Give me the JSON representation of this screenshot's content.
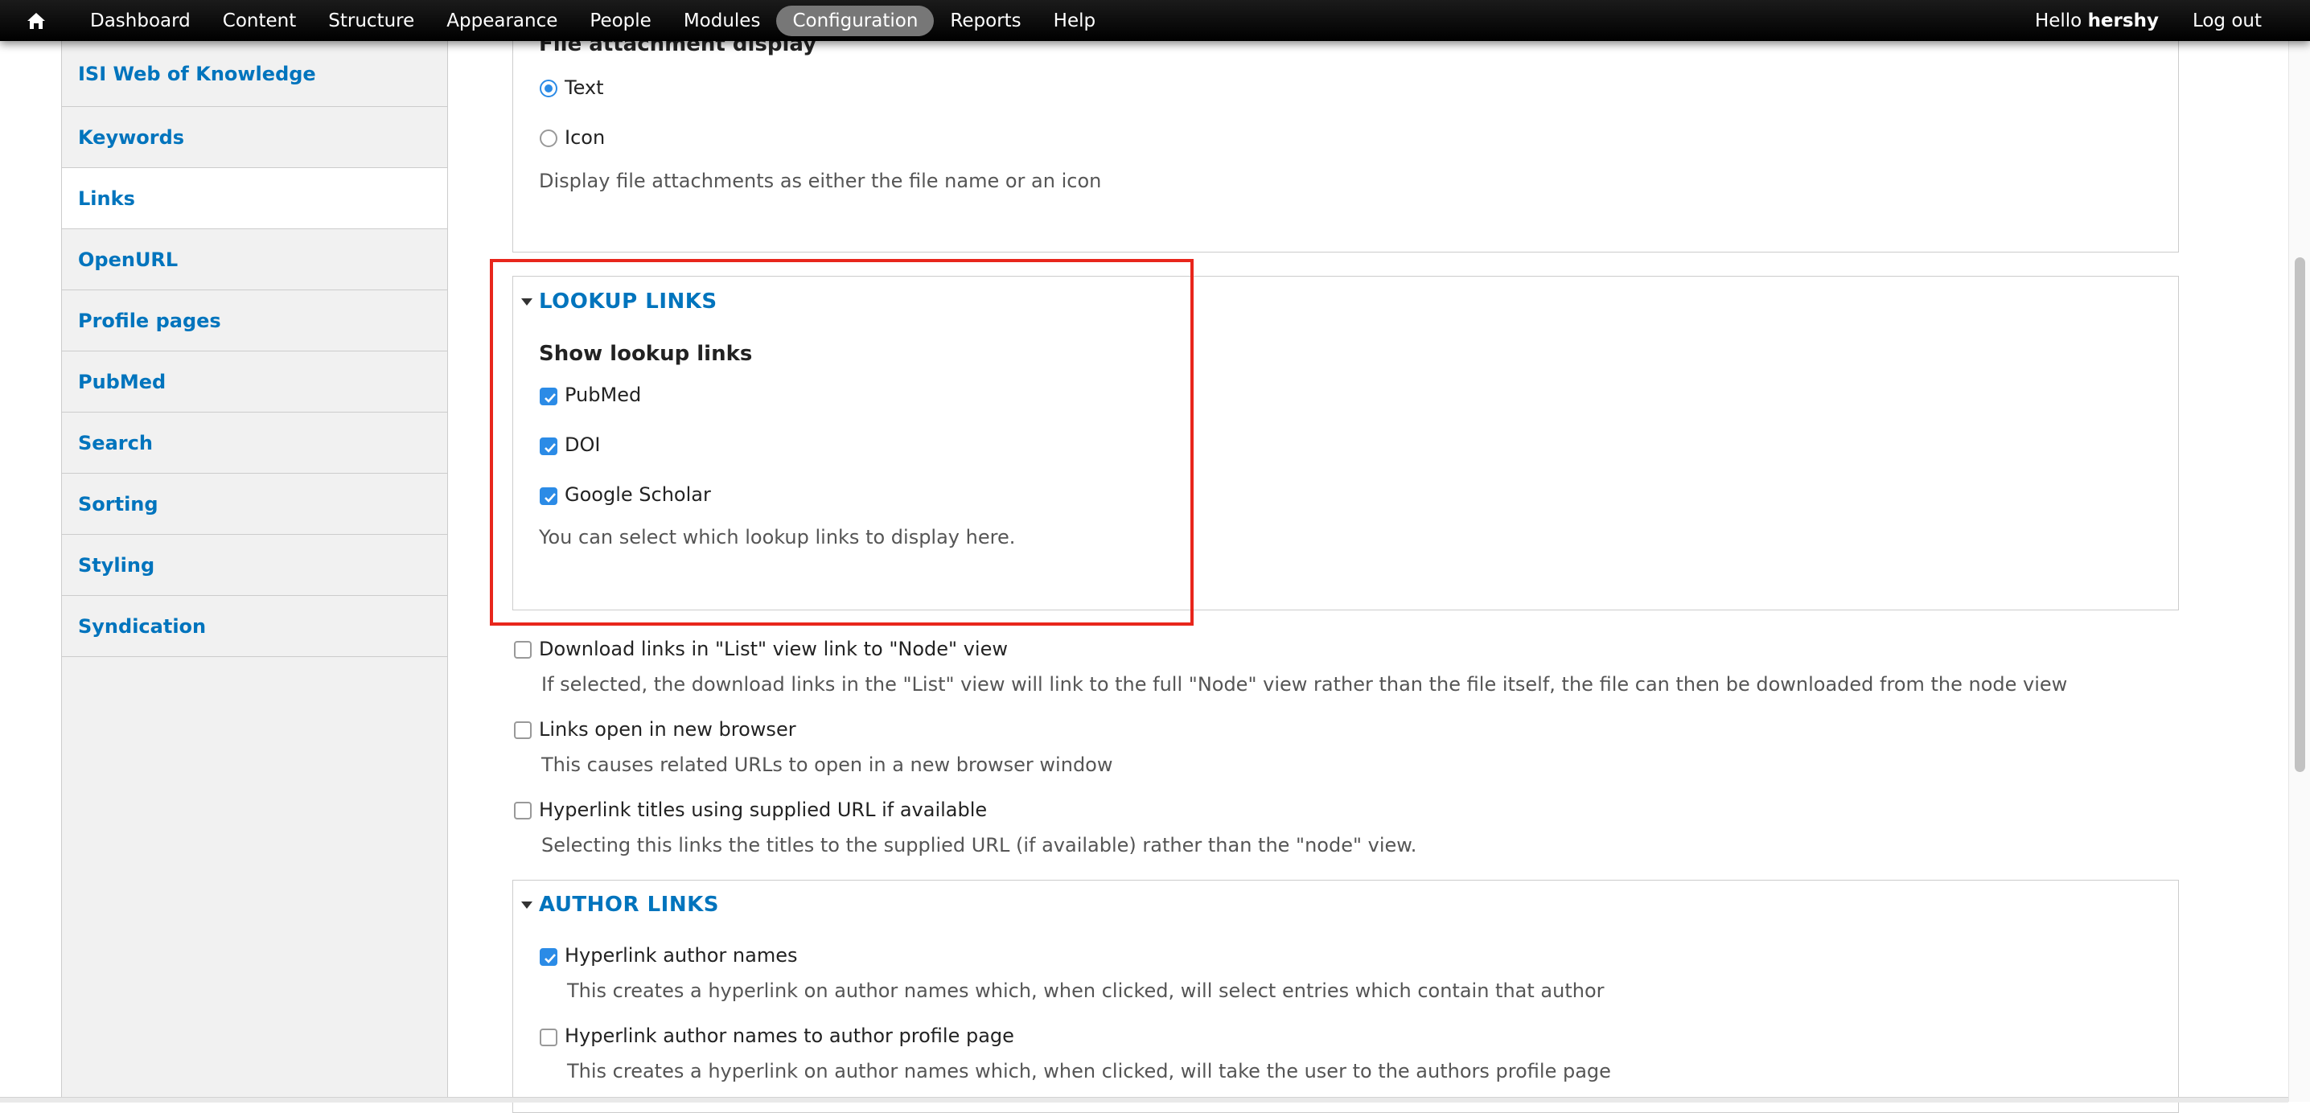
{
  "toolbar": {
    "items": [
      "Dashboard",
      "Content",
      "Structure",
      "Appearance",
      "People",
      "Modules",
      "Configuration",
      "Reports",
      "Help"
    ],
    "active": "Configuration",
    "greeting_prefix": "Hello ",
    "username": "hershy",
    "logout": "Log out"
  },
  "sidebar": {
    "items": [
      {
        "label": "ISI Web of Knowledge"
      },
      {
        "label": "Keywords"
      },
      {
        "label": "Links"
      },
      {
        "label": "OpenURL"
      },
      {
        "label": "Profile pages"
      },
      {
        "label": "PubMed"
      },
      {
        "label": "Search"
      },
      {
        "label": "Sorting"
      },
      {
        "label": "Styling"
      },
      {
        "label": "Syndication"
      }
    ],
    "selected": "Links"
  },
  "file_attachment": {
    "title": "File attachment display",
    "options": [
      {
        "label": "Text",
        "checked": true
      },
      {
        "label": "Icon",
        "checked": false
      }
    ],
    "description": "Display file attachments as either the file name or an icon"
  },
  "lookup_links": {
    "legend": "LOOKUP LINKS",
    "title": "Show lookup links",
    "options": [
      {
        "label": "PubMed",
        "checked": true
      },
      {
        "label": "DOI",
        "checked": true
      },
      {
        "label": "Google Scholar",
        "checked": true
      }
    ],
    "description": "You can select which lookup links to display here."
  },
  "standalone": [
    {
      "label": "Download links in \"List\" view link to \"Node\" view",
      "checked": false,
      "description": "If selected, the download links in the \"List\" view will link to the full \"Node\" view rather than the file itself, the file can then be downloaded from the node view"
    },
    {
      "label": "Links open in new browser",
      "checked": false,
      "description": "This causes related URLs to open in a new browser window"
    },
    {
      "label": "Hyperlink titles using supplied URL if available",
      "checked": false,
      "description": "Selecting this links the titles to the supplied URL (if available) rather than the \"node\" view."
    }
  ],
  "author_links": {
    "legend": "AUTHOR LINKS",
    "options": [
      {
        "label": "Hyperlink author names",
        "checked": true,
        "description": "This creates a hyperlink on author names which, when clicked, will select entries which contain that author"
      },
      {
        "label": "Hyperlink author names to author profile page",
        "checked": false,
        "description": "This creates a hyperlink on author names which, when clicked, will take the user to the authors profile page"
      }
    ]
  },
  "colors": {
    "link": "#0074bd",
    "highlight": "#e8261c",
    "toolbar": "#000000",
    "checkbox": "#2b8be6"
  }
}
